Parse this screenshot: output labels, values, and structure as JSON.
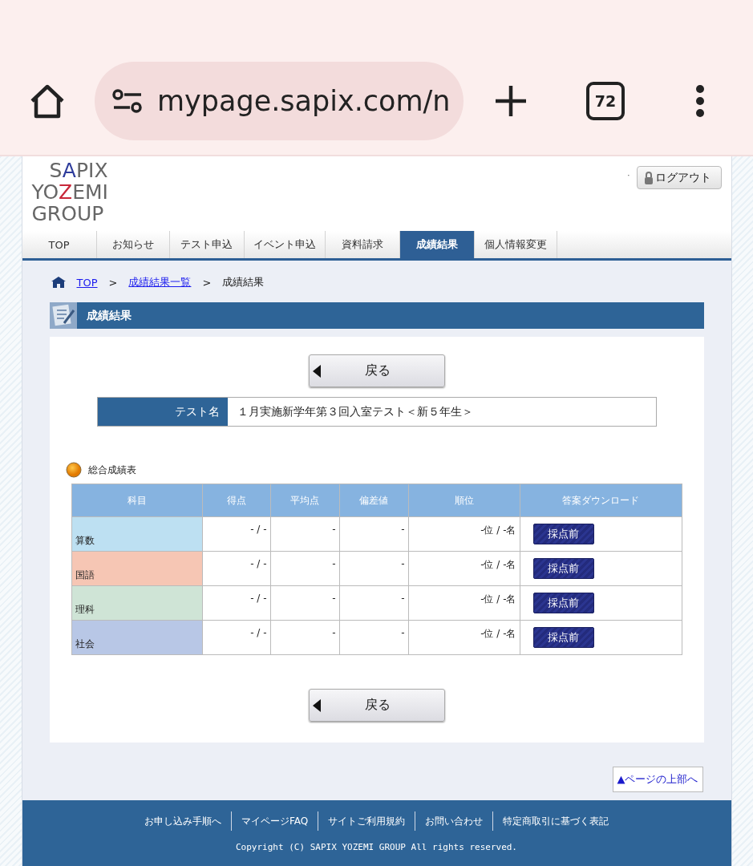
{
  "browser": {
    "url": "mypage.sapix.com/n",
    "tab_count": "72"
  },
  "logo": {
    "lines": [
      [
        {
          "text": "S"
        },
        {
          "text": "A",
          "color": "#2e3c9c"
        },
        {
          "text": "PIX"
        }
      ],
      [
        {
          "text": "YO"
        },
        {
          "text": "Z",
          "color": "#c8283a"
        },
        {
          "text": "EMI"
        }
      ],
      [
        {
          "text": "GROUP"
        }
      ]
    ]
  },
  "header_dot": "·",
  "logout": "ログアウト",
  "nav": [
    {
      "label": "TOP",
      "selected": false
    },
    {
      "label": "お知らせ",
      "selected": false
    },
    {
      "label": "テスト申込",
      "selected": false
    },
    {
      "label": "イベント申込",
      "selected": false
    },
    {
      "label": "資料請求",
      "selected": false
    },
    {
      "label": "成績結果",
      "selected": true
    },
    {
      "label": "個人情報変更",
      "selected": false
    }
  ],
  "breadcrumb": [
    {
      "label": "TOP",
      "link": true
    },
    {
      "label": "成績結果一覧",
      "link": true
    },
    {
      "label": "成績結果",
      "link": false
    }
  ],
  "breadcrumb_separator": ">",
  "page_title": "成績結果",
  "back_button": "戻る",
  "test_name": {
    "label": "テスト名",
    "value": "１月実施新学年第３回入室テスト＜新５年生＞"
  },
  "section_title": "総合成績表",
  "table": {
    "columns": [
      "科目",
      "得点",
      "平均点",
      "偏差値",
      "順位",
      "答案ダウンロード"
    ],
    "rows": [
      {
        "subject": "算数",
        "color": "#bde0f2",
        "score": "- / -",
        "average": "-",
        "deviation": "-",
        "rank": "-位 / -名",
        "download": "採点前"
      },
      {
        "subject": "国語",
        "color": "#f6c6b4",
        "score": "- / -",
        "average": "-",
        "deviation": "-",
        "rank": "-位 / -名",
        "download": "採点前"
      },
      {
        "subject": "理科",
        "color": "#cfe4d6",
        "score": "- / -",
        "average": "-",
        "deviation": "-",
        "rank": "-位 / -名",
        "download": "採点前"
      },
      {
        "subject": "社会",
        "color": "#b8c7e6",
        "score": "- / -",
        "average": "-",
        "deviation": "-",
        "rank": "-位 / -名",
        "download": "採点前"
      }
    ]
  },
  "back_button_bottom": "戻る",
  "page_top": "▲ページの上部へ",
  "footer": {
    "links": [
      "お申し込み手順へ",
      "マイページFAQ",
      "サイトご利用規約",
      "お問い合わせ",
      "特定商取引に基づく表記"
    ],
    "copyright": "Copyright (C) SAPIX YOZEMI GROUP All rights reserved."
  }
}
